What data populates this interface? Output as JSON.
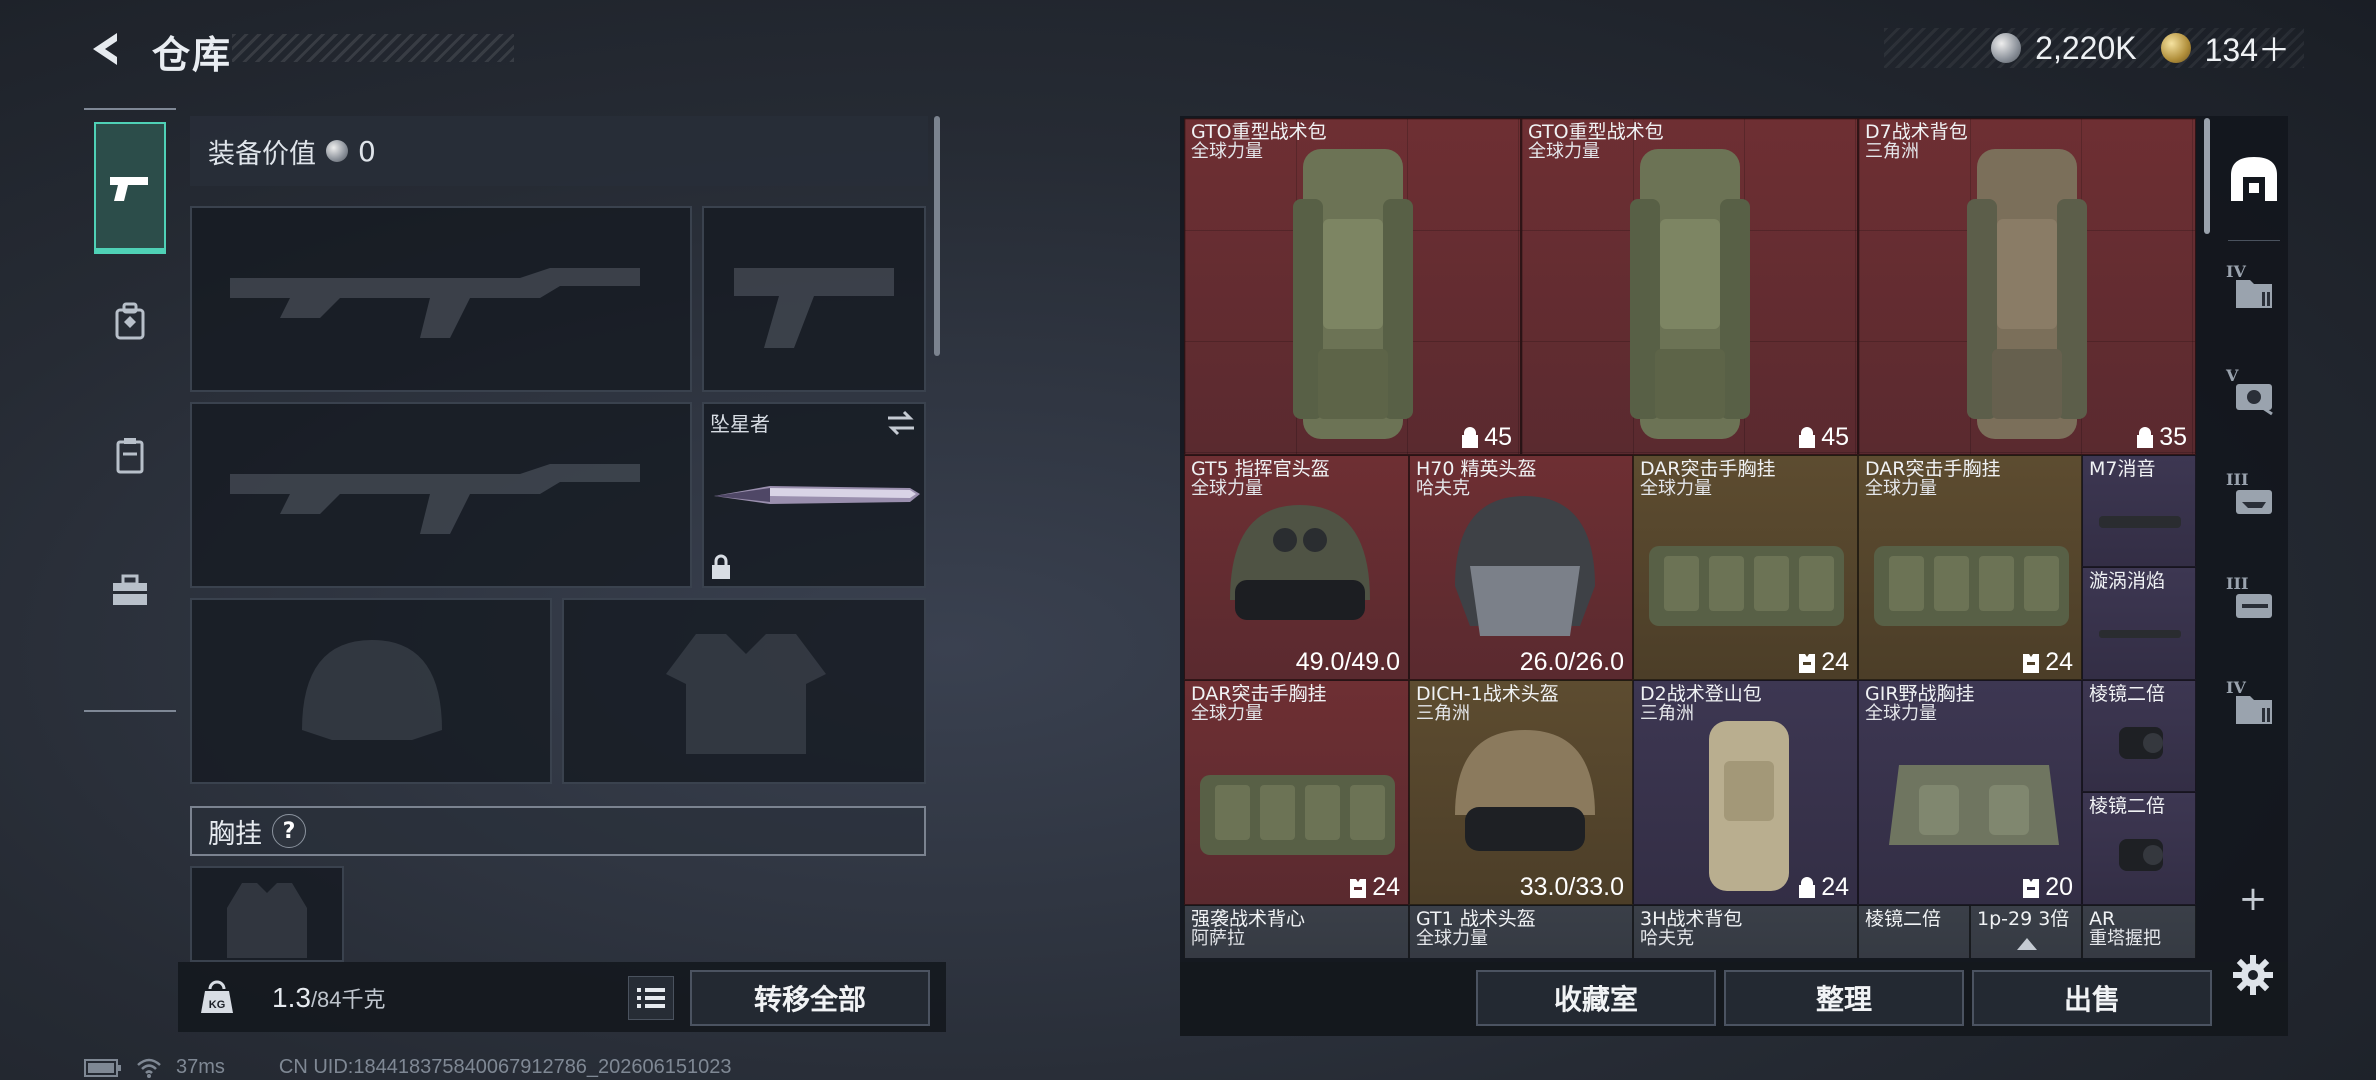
{
  "header": {
    "title": "仓库",
    "currency": [
      {
        "icon": "silver-coin-icon",
        "value": "2,220K"
      },
      {
        "icon": "gold-coin-icon",
        "value": "134＋"
      }
    ]
  },
  "equipment": {
    "value_label": "装备价值",
    "value": "0",
    "melee_label": "坠星者",
    "chest_label": "胸挂",
    "help": "?",
    "weight_current": "1.3",
    "weight_max": "/84千克",
    "transfer_all": "转移全部"
  },
  "category_tabs": [
    "weapons",
    "gear",
    "consumables",
    "keys"
  ],
  "storage": {
    "items": [
      {
        "name": "GTO重型战术包",
        "sub": "全球力量",
        "stat": "45",
        "stat_icon": "capacity-icon",
        "rarity": "red"
      },
      {
        "name": "GTO重型战术包",
        "sub": "全球力量",
        "stat": "45",
        "stat_icon": "capacity-icon",
        "rarity": "red"
      },
      {
        "name": "D7战术背包",
        "sub": "三角洲",
        "stat": "35",
        "stat_icon": "capacity-icon",
        "rarity": "red"
      },
      {
        "name": "GT5 指挥官头盔",
        "sub": "全球力量",
        "stat": "49.0/49.0",
        "rarity": "red"
      },
      {
        "name": "H70 精英头盔",
        "sub": "哈夫克",
        "stat": "26.0/26.0",
        "rarity": "red"
      },
      {
        "name": "DAR突击手胸挂",
        "sub": "全球力量",
        "stat": "24",
        "stat_icon": "vest-capacity-icon",
        "rarity": "gold"
      },
      {
        "name": "DAR突击手胸挂",
        "sub": "全球力量",
        "stat": "24",
        "stat_icon": "vest-capacity-icon",
        "rarity": "gold"
      },
      {
        "name": "M7消音",
        "sub": "",
        "stat": "",
        "rarity": "purple"
      },
      {
        "name": "漩涡消焰",
        "sub": "",
        "stat": "",
        "rarity": "purple"
      },
      {
        "name": "DAR突击手胸挂",
        "sub": "全球力量",
        "stat": "24",
        "stat_icon": "vest-capacity-icon",
        "rarity": "gold"
      },
      {
        "name": "DICH-1战术头盔",
        "sub": "三角洲",
        "stat": "33.0/33.0",
        "rarity": "gold"
      },
      {
        "name": "D2战术登山包",
        "sub": "三角洲",
        "stat": "24",
        "stat_icon": "capacity-icon",
        "rarity": "purple"
      },
      {
        "name": "GIR野战胸挂",
        "sub": "全球力量",
        "stat": "20",
        "stat_icon": "vest-capacity-icon",
        "rarity": "purple"
      },
      {
        "name": "棱镜二倍",
        "sub": "",
        "stat": "",
        "rarity": "purple"
      },
      {
        "name": "棱镜二倍",
        "sub": "",
        "stat": "",
        "rarity": "purple"
      },
      {
        "name": "强袭战术背心",
        "sub": "阿萨拉",
        "stat": "",
        "rarity": "gray"
      },
      {
        "name": "GT1 战术头盔",
        "sub": "全球力量",
        "stat": "",
        "rarity": "gray"
      },
      {
        "name": "3H战术背包",
        "sub": "哈夫克",
        "stat": "",
        "rarity": "gray"
      },
      {
        "name": "棱镜二倍",
        "sub": "",
        "stat": "",
        "rarity": "gray"
      },
      {
        "name": "1p-29 3倍",
        "sub": "",
        "stat": "",
        "rarity": "gray"
      },
      {
        "name": "AR",
        "sub": "重塔握把",
        "stat": "",
        "rarity": "gray"
      }
    ],
    "actions": {
      "collection": "收藏室",
      "sort": "整理",
      "sell": "出售"
    }
  },
  "sidebar": {
    "tabs": [
      {
        "roman": "",
        "icon": "storage-home-icon"
      },
      {
        "roman": "IV",
        "icon": "folder-ammo-icon"
      },
      {
        "roman": "V",
        "icon": "gear-case-icon"
      },
      {
        "roman": "III",
        "icon": "weapon-rack-icon"
      },
      {
        "roman": "III",
        "icon": "weapon-rack-icon"
      },
      {
        "roman": "IV",
        "icon": "folder-ammo-icon"
      }
    ],
    "add": "+"
  },
  "status": {
    "ping": "37ms",
    "uid": "CN UID:18441837584006791278​6_202606151023"
  }
}
